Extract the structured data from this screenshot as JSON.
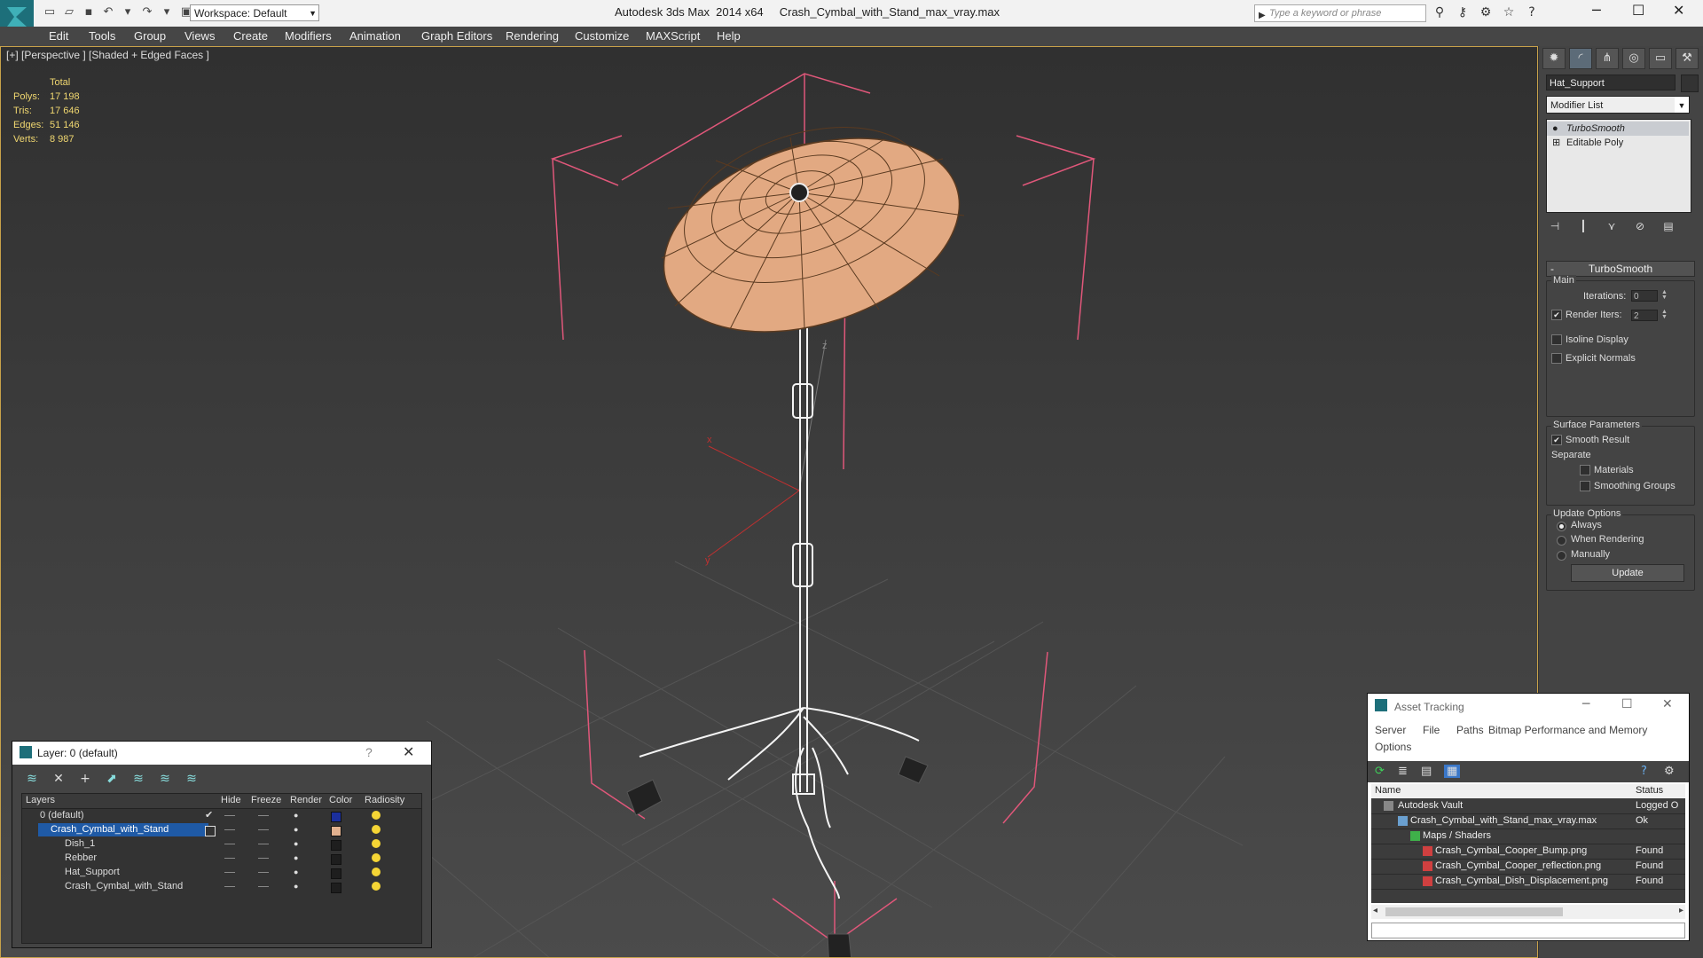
{
  "titlebar": {
    "workspace": "Workspace: Default",
    "app_title": "Autodesk 3ds Max  2014 x64",
    "file_title": "Crash_Cymbal_with_Stand_max_vray.max",
    "search_placeholder": "Type a keyword or phrase"
  },
  "menu": [
    "Edit",
    "Tools",
    "Group",
    "Views",
    "Create",
    "Modifiers",
    "Animation",
    "Graph Editors",
    "Rendering",
    "Customize",
    "MAXScript",
    "Help"
  ],
  "viewport": {
    "label": "[+] [Perspective ] [Shaded + Edged Faces ]",
    "stats": {
      "header": "Total",
      "rows": [
        {
          "label": "Polys:",
          "value": "17 198"
        },
        {
          "label": "Tris:",
          "value": "17 646"
        },
        {
          "label": "Edges:",
          "value": "51 146"
        },
        {
          "label": "Verts:",
          "value": "8 987"
        }
      ]
    },
    "axis_labels": {
      "x": "x",
      "y": "y",
      "z": "z"
    }
  },
  "command_panel": {
    "object_name": "Hat_Support",
    "modifier_list": "Modifier List",
    "stack": [
      "TurboSmooth",
      "Editable Poly"
    ],
    "rollout": {
      "title": "TurboSmooth",
      "main": "Main",
      "iterations_label": "Iterations:",
      "iterations": "0",
      "render_iters_label": "Render Iters:",
      "render_iters": "2",
      "isoline": "Isoline Display",
      "explicit_normals": "Explicit Normals",
      "surface_params": "Surface Parameters",
      "smooth_result": "Smooth Result",
      "separate": "Separate",
      "materials": "Materials",
      "smoothing_groups": "Smoothing Groups",
      "update_options": "Update Options",
      "always": "Always",
      "when_rendering": "When Rendering",
      "manually": "Manually",
      "update_button": "Update"
    }
  },
  "layer_manager": {
    "title": "Layer: 0 (default)",
    "columns": [
      "Layers",
      "Hide",
      "Freeze",
      "Render",
      "Color",
      "Radiosity"
    ],
    "rows": [
      {
        "name": "0 (default)",
        "color": "#1b2f9c"
      },
      {
        "name": "Crash_Cymbal_with_Stand",
        "color": "#e2b18f"
      },
      {
        "name": "Dish_1",
        "color": "#1e1e1e"
      },
      {
        "name": "Rebber",
        "color": "#1e1e1e"
      },
      {
        "name": "Hat_Support",
        "color": "#1e1e1e"
      },
      {
        "name": "Crash_Cymbal_with_Stand",
        "color": "#1e1e1e"
      }
    ]
  },
  "asset_tracking": {
    "title": "Asset Tracking",
    "menu": [
      "Server",
      "File",
      "Paths",
      "Bitmap Performance and Memory",
      "Options"
    ],
    "columns": [
      "Name",
      "Status"
    ],
    "rows": [
      {
        "name": "Autodesk Vault",
        "status": "Logged O"
      },
      {
        "name": "Crash_Cymbal_with_Stand_max_vray.max",
        "status": "Ok"
      },
      {
        "name": "Maps / Shaders",
        "status": ""
      },
      {
        "name": "Crash_Cymbal_Cooper_Bump.png",
        "status": "Found"
      },
      {
        "name": "Crash_Cymbal_Cooper_reflection.png",
        "status": "Found"
      },
      {
        "name": "Crash_Cymbal_Dish_Displacement.png",
        "status": "Found"
      }
    ]
  }
}
